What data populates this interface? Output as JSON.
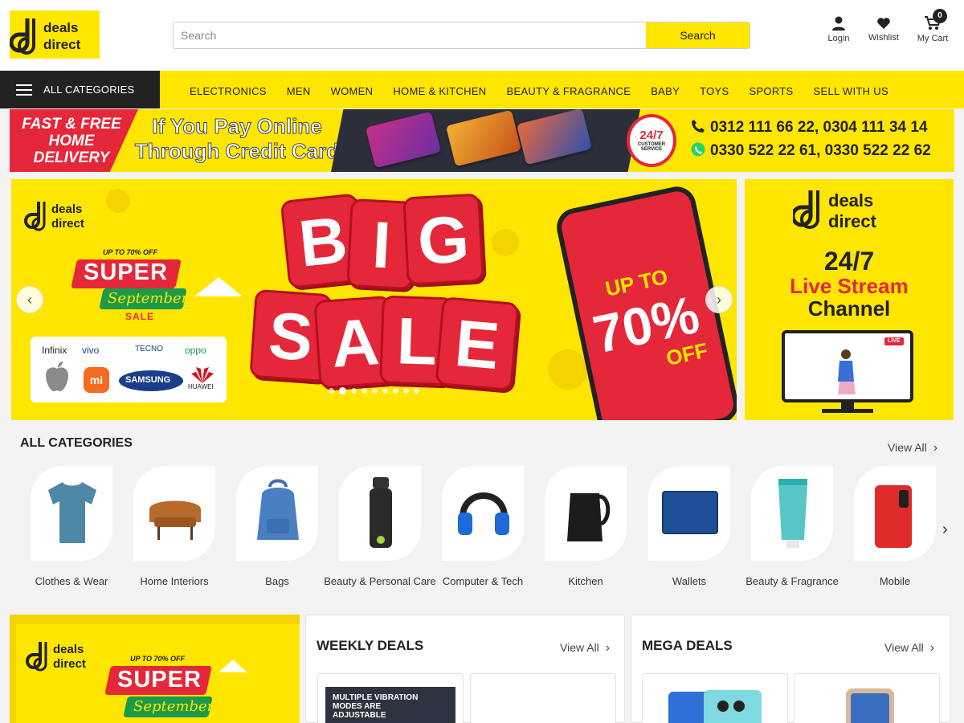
{
  "header": {
    "logo_text_line1": "deals",
    "logo_text_line2": "direct",
    "search_placeholder": "Search",
    "search_button": "Search",
    "login_label": "Login",
    "wishlist_label": "Wishlist",
    "cart_label": "My Cart",
    "cart_count": "0"
  },
  "nav": {
    "all_categories": "ALL CATEGORIES",
    "links": [
      "ELECTRONICS",
      "MEN",
      "WOMEN",
      "HOME & KITCHEN",
      "BEAUTY & FRAGRANCE",
      "BABY",
      "TOYS",
      "SPORTS",
      "SELL WITH US"
    ]
  },
  "promo": {
    "delivery_line1": "FAST & FREE",
    "delivery_line2": "HOME",
    "delivery_line3": "DELIVERY",
    "pay_line1": "If You Pay Online",
    "pay_line2": "Through Credit Card",
    "badge_big": "24/7",
    "badge_small": "CUSTOMER SERVICE",
    "phones": "0312 111 66 22,  0304 111 34 14",
    "whatsapp": "0330 522 22 61,  0330 522 22 62"
  },
  "hero": {
    "offer_small": "UP TO 70% OFF",
    "super": "SUPER",
    "september": "September",
    "sale_tag": "SALE",
    "big_letters": [
      "B",
      "I",
      "G",
      "S",
      "A",
      "L",
      "E"
    ],
    "phone_upto": "UP TO",
    "phone_pct": "70%",
    "phone_off": "OFF",
    "brands": [
      "Infinix",
      "vivo",
      "TECNO",
      "oppo",
      "SAMSUNG",
      "HUAWEI"
    ],
    "slide_count": 9,
    "active_slide": 1
  },
  "side_banner": {
    "line1": "24/7",
    "line2": "Live Stream",
    "line3": "Channel",
    "live_badge": "LIVE"
  },
  "categories": {
    "title": "ALL CATEGORIES",
    "view_all": "View All",
    "items": [
      {
        "label": "Clothes & Wear",
        "icon": "tshirt-icon"
      },
      {
        "label": "Home Interiors",
        "icon": "armchair-icon"
      },
      {
        "label": "Bags",
        "icon": "backpack-icon"
      },
      {
        "label": "Beauty & Personal Care",
        "icon": "bottle-icon"
      },
      {
        "label": "Computer & Tech",
        "icon": "headset-icon"
      },
      {
        "label": "Kitchen",
        "icon": "kettle-icon"
      },
      {
        "label": "Wallets",
        "icon": "wallet-icon"
      },
      {
        "label": "Beauty & Fragrance",
        "icon": "tube-icon"
      },
      {
        "label": "Mobile",
        "icon": "phone-icon"
      }
    ]
  },
  "weekly_deals": {
    "title": "WEEKLY DEALS",
    "view_all": "View All",
    "card_text": "MULTIPLE VIBRATION MODES ARE ADJUSTABLE"
  },
  "mega_deals": {
    "title": "MEGA DEALS",
    "view_all": "View All"
  },
  "colors": {
    "brand_yellow": "#ffe600",
    "brand_red": "#e5273a",
    "dark": "#222222"
  }
}
